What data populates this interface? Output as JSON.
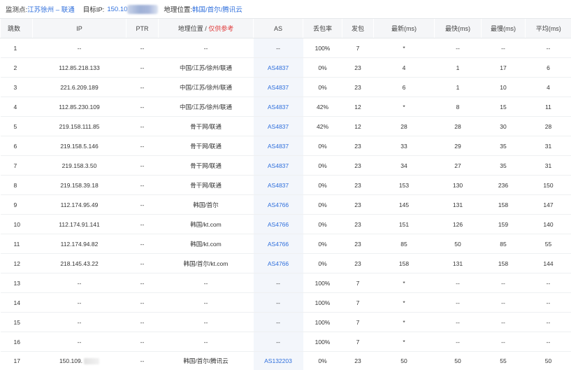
{
  "header": {
    "monitor_label": "监测点:",
    "monitor_value": "江苏徐州 – 联通",
    "target_label": "目标IP:",
    "target_value": "150.10",
    "location_label": "地理位置:",
    "location_value": "韩国/首尔/腾讯云"
  },
  "table": {
    "columns": {
      "hop": "跳数",
      "ip": "IP",
      "ptr": "PTR",
      "geo": "地理位置",
      "geo_sep": " / ",
      "geo_ref": "仅供参考",
      "as": "AS",
      "loss": "丢包率",
      "sent": "发包",
      "latest": "最新(ms)",
      "fastest": "最快(ms)",
      "slowest": "最慢(ms)",
      "avg": "平均(ms)"
    },
    "rows": [
      {
        "hop": "1",
        "ip": "--",
        "ptr": "--",
        "geo": "--",
        "as": "--",
        "loss": "100%",
        "sent": "7",
        "latest": "*",
        "fastest": "--",
        "slowest": "--",
        "avg": "--"
      },
      {
        "hop": "2",
        "ip": "112.85.218.133",
        "ptr": "--",
        "geo": "中国/江苏/徐州/联通",
        "as": "AS4837",
        "loss": "0%",
        "sent": "23",
        "latest": "4",
        "fastest": "1",
        "slowest": "17",
        "avg": "6"
      },
      {
        "hop": "3",
        "ip": "221.6.209.189",
        "ptr": "--",
        "geo": "中国/江苏/徐州/联通",
        "as": "AS4837",
        "loss": "0%",
        "sent": "23",
        "latest": "6",
        "fastest": "1",
        "slowest": "10",
        "avg": "4"
      },
      {
        "hop": "4",
        "ip": "112.85.230.109",
        "ptr": "--",
        "geo": "中国/江苏/徐州/联通",
        "as": "AS4837",
        "loss": "42%",
        "sent": "12",
        "latest": "*",
        "fastest": "8",
        "slowest": "15",
        "avg": "11"
      },
      {
        "hop": "5",
        "ip": "219.158.111.85",
        "ptr": "--",
        "geo": "骨干网/联通",
        "as": "AS4837",
        "loss": "42%",
        "sent": "12",
        "latest": "28",
        "fastest": "28",
        "slowest": "30",
        "avg": "28"
      },
      {
        "hop": "6",
        "ip": "219.158.5.146",
        "ptr": "--",
        "geo": "骨干网/联通",
        "as": "AS4837",
        "loss": "0%",
        "sent": "23",
        "latest": "33",
        "fastest": "29",
        "slowest": "35",
        "avg": "31"
      },
      {
        "hop": "7",
        "ip": "219.158.3.50",
        "ptr": "--",
        "geo": "骨干网/联通",
        "as": "AS4837",
        "loss": "0%",
        "sent": "23",
        "latest": "34",
        "fastest": "27",
        "slowest": "35",
        "avg": "31"
      },
      {
        "hop": "8",
        "ip": "219.158.39.18",
        "ptr": "--",
        "geo": "骨干网/联通",
        "as": "AS4837",
        "loss": "0%",
        "sent": "23",
        "latest": "153",
        "fastest": "130",
        "slowest": "236",
        "avg": "150"
      },
      {
        "hop": "9",
        "ip": "112.174.95.49",
        "ptr": "--",
        "geo": "韩国/首尔",
        "as": "AS4766",
        "loss": "0%",
        "sent": "23",
        "latest": "145",
        "fastest": "131",
        "slowest": "158",
        "avg": "147"
      },
      {
        "hop": "10",
        "ip": "112.174.91.141",
        "ptr": "--",
        "geo": "韩国/kt.com",
        "as": "AS4766",
        "loss": "0%",
        "sent": "23",
        "latest": "151",
        "fastest": "126",
        "slowest": "159",
        "avg": "140"
      },
      {
        "hop": "11",
        "ip": "112.174.94.82",
        "ptr": "--",
        "geo": "韩国/kt.com",
        "as": "AS4766",
        "loss": "0%",
        "sent": "23",
        "latest": "85",
        "fastest": "50",
        "slowest": "85",
        "avg": "55"
      },
      {
        "hop": "12",
        "ip": "218.145.43.22",
        "ptr": "--",
        "geo": "韩国/首尔/kt.com",
        "as": "AS4766",
        "loss": "0%",
        "sent": "23",
        "latest": "158",
        "fastest": "131",
        "slowest": "158",
        "avg": "144"
      },
      {
        "hop": "13",
        "ip": "--",
        "ptr": "--",
        "geo": "--",
        "as": "--",
        "loss": "100%",
        "sent": "7",
        "latest": "*",
        "fastest": "--",
        "slowest": "--",
        "avg": "--"
      },
      {
        "hop": "14",
        "ip": "--",
        "ptr": "--",
        "geo": "--",
        "as": "--",
        "loss": "100%",
        "sent": "7",
        "latest": "*",
        "fastest": "--",
        "slowest": "--",
        "avg": "--"
      },
      {
        "hop": "15",
        "ip": "--",
        "ptr": "--",
        "geo": "--",
        "as": "--",
        "loss": "100%",
        "sent": "7",
        "latest": "*",
        "fastest": "--",
        "slowest": "--",
        "avg": "--"
      },
      {
        "hop": "16",
        "ip": "--",
        "ptr": "--",
        "geo": "--",
        "as": "--",
        "loss": "100%",
        "sent": "7",
        "latest": "*",
        "fastest": "--",
        "slowest": "--",
        "avg": "--"
      },
      {
        "hop": "17",
        "ip": "150.109.",
        "ptr": "--",
        "geo": "韩国/首尔/腾讯云",
        "as": "AS132203",
        "loss": "0%",
        "sent": "23",
        "latest": "50",
        "fastest": "50",
        "slowest": "55",
        "avg": "50"
      }
    ]
  },
  "colors": {
    "link": "#2f6fdc",
    "reference_note": "#e03c3c",
    "header_bg": "#f5f6f8",
    "as_cell_bg": "#f3f6fb"
  }
}
